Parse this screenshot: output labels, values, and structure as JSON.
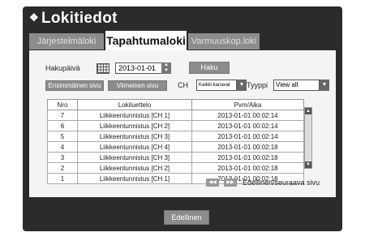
{
  "window": {
    "title": "Lokitiedot"
  },
  "tabs": [
    {
      "label": "Järjestelmäloki",
      "active": false
    },
    {
      "label": "Tapahtumaloki",
      "active": true
    },
    {
      "label": "Varmuuskop.loki",
      "active": false
    }
  ],
  "search": {
    "date_label": "Hakupäivä",
    "date_value": "2013-01-01",
    "search_button": "Haku"
  },
  "nav": {
    "first_page": "Ensimmäinen sivu",
    "last_page": "Viimeinen sivu",
    "ch_label": "CH",
    "ch_value": "Kaikki kanavat",
    "type_label": "Tyyppi",
    "type_value": "View all"
  },
  "table": {
    "headers": [
      "Nro",
      "Lokiluettelo",
      "Pvm/Aika"
    ],
    "rows": [
      [
        "7",
        "Liikkeentunnistus [CH 1]",
        "2013-01-01 00:02:14"
      ],
      [
        "6",
        "Liikkeentunnistus [CH 2]",
        "2013-01-01 00:02:14"
      ],
      [
        "5",
        "Liikkeentunnistus [CH 3]",
        "2013-01-01 00:02:14"
      ],
      [
        "4",
        "Liikkeentunnistus [CH 4]",
        "2013-01-01 00:02:18"
      ],
      [
        "3",
        "Liikkeentunnistus [CH 3]",
        "2013-01-01 00:02:18"
      ],
      [
        "2",
        "Liikkeentunnistus [CH 2]",
        "2013-01-01 00:02:18"
      ],
      [
        "1",
        "Liikkeentunnistus [CH 1]",
        "2013-01-01 00:02:18"
      ]
    ]
  },
  "pagination": {
    "label": "Edellinen/seuraava sivu"
  },
  "footer": {
    "back_button": "Edellinen"
  }
}
